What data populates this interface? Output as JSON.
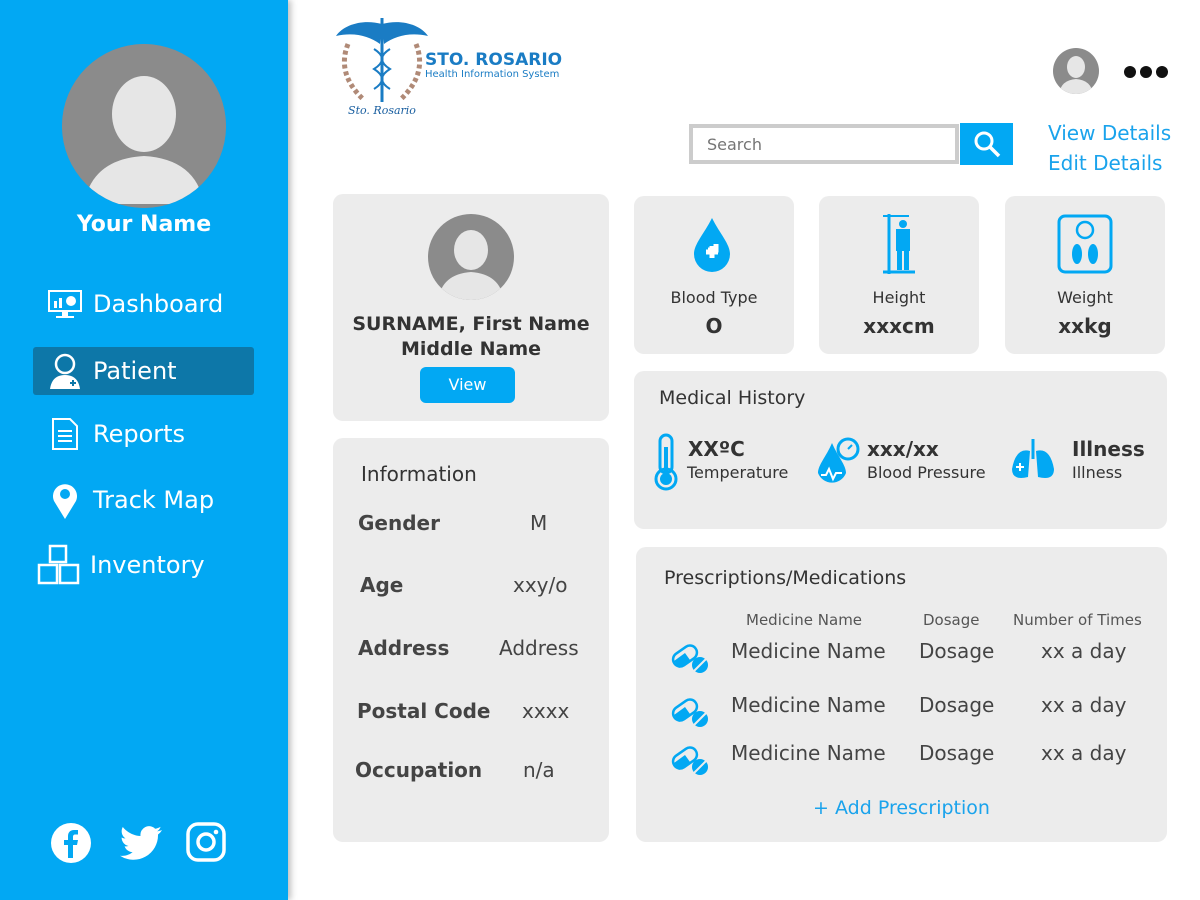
{
  "sidebar": {
    "user_name": "Your Name",
    "items": [
      {
        "label": "Dashboard",
        "icon": "dashboard-icon"
      },
      {
        "label": "Patient",
        "icon": "patient-icon",
        "active": true
      },
      {
        "label": "Reports",
        "icon": "document-icon"
      },
      {
        "label": "Track Map",
        "icon": "map-pin-icon"
      },
      {
        "label": "Inventory",
        "icon": "boxes-icon"
      }
    ],
    "social": [
      "facebook-icon",
      "twitter-icon",
      "instagram-icon"
    ]
  },
  "header": {
    "logo_title": "STO. ROSARIO",
    "logo_subtitle": "Health Information System",
    "logo_seal_text": "Sto. Rosario",
    "search_placeholder": "Search",
    "view_details": "View Details",
    "edit_details": "Edit Details"
  },
  "patient": {
    "name_line1": "SURNAME, First Name",
    "name_line2": "Middle Name",
    "view_label": "View"
  },
  "vitals": [
    {
      "label": "Blood Type",
      "value": "O"
    },
    {
      "label": "Height",
      "value": "xxxcm"
    },
    {
      "label": "Weight",
      "value": "xxkg"
    }
  ],
  "info": {
    "title": "Information",
    "rows": [
      {
        "label": "Gender",
        "value": "M"
      },
      {
        "label": "Age",
        "value": "xxy/o"
      },
      {
        "label": "Address",
        "value": "Address"
      },
      {
        "label": "Postal Code",
        "value": "xxxx"
      },
      {
        "label": "Occupation",
        "value": "n/a"
      }
    ]
  },
  "history": {
    "title": "Medical History",
    "items": [
      {
        "value": "XXºC",
        "label": "Temperature"
      },
      {
        "value": "xxx/xx",
        "label": "Blood Pressure"
      },
      {
        "value": "Illness",
        "label": "Illness"
      }
    ]
  },
  "prescriptions": {
    "title": "Prescriptions/Medications",
    "headers": [
      "Medicine Name",
      "Dosage",
      "Number of Times"
    ],
    "rows": [
      {
        "name": "Medicine Name",
        "dosage": "Dosage",
        "times": "xx a day"
      },
      {
        "name": "Medicine Name",
        "dosage": "Dosage",
        "times": "xx a day"
      },
      {
        "name": "Medicine Name",
        "dosage": "Dosage",
        "times": "xx a day"
      }
    ],
    "add_label": "+ Add Prescription"
  },
  "colors": {
    "primary": "#02a8f3",
    "active": "#0d77a8",
    "card": "#ececec"
  }
}
